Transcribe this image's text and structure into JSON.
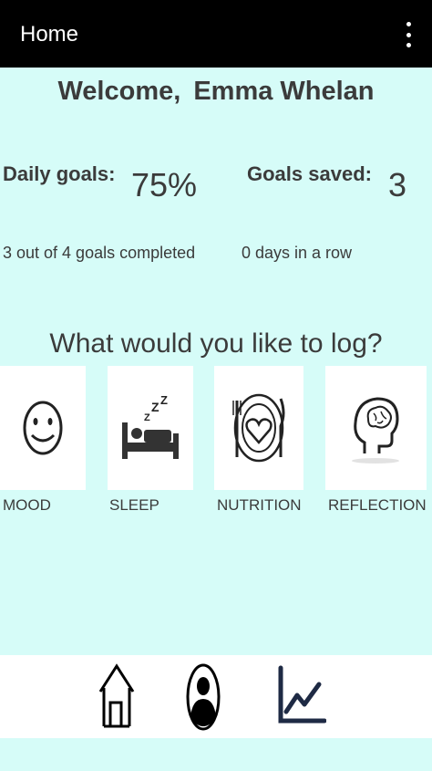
{
  "appbar": {
    "title": "Home",
    "overflow_icon": "more-vert-icon"
  },
  "welcome": {
    "greeting": "Welcome,",
    "name": "Emma Whelan"
  },
  "stats": {
    "daily_goals_label": "Daily goals:",
    "daily_goals_value": "75%",
    "daily_goals_percent": 75,
    "goals_saved_label": "Goals saved:",
    "goals_saved_value": "3",
    "completed_text": "3 out of 4 goals completed",
    "streak_text": "0 days in a row"
  },
  "log": {
    "title": "What would you like to log?",
    "items": [
      {
        "label": "MOOD",
        "icon": "smiley-face-icon"
      },
      {
        "label": "SLEEP",
        "icon": "sleep-bed-icon"
      },
      {
        "label": "NUTRITION",
        "icon": "plate-heart-icon"
      },
      {
        "label": "REFLECTION",
        "icon": "brain-head-icon"
      }
    ]
  },
  "bottom_nav": {
    "items": [
      {
        "icon": "home-icon"
      },
      {
        "icon": "profile-icon"
      },
      {
        "icon": "chart-icon"
      }
    ]
  },
  "colors": {
    "background": "#d6fcf8",
    "appbar": "#000000",
    "text": "#3b3b3b",
    "tile": "#ffffff",
    "chart_icon": "#1e2a44"
  }
}
